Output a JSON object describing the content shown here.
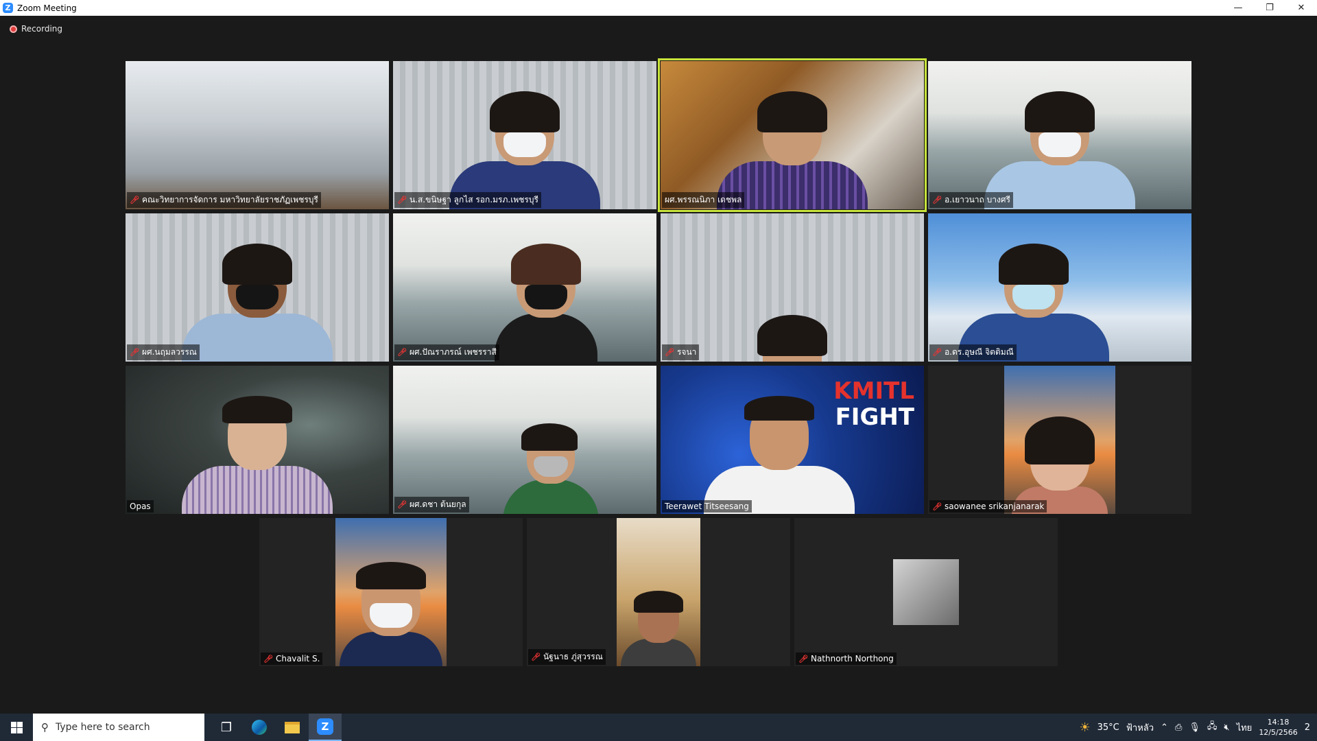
{
  "window": {
    "title": "Zoom Meeting",
    "logo_letter": "Z",
    "minimize": "—",
    "restore": "❐",
    "close": "✕"
  },
  "meeting": {
    "recording_label": "Recording",
    "active_speaker_color": "#c8e33a"
  },
  "participants": [
    {
      "name": "คณะวิทยาการจัดการ มหาวิทยาลัยราชภัฏเพชรบุรี",
      "muted": true,
      "active": false
    },
    {
      "name": "น.ส.ขนิษฐา ลูกไส รอก.มรภ.เพชรบุรี",
      "muted": true,
      "active": false
    },
    {
      "name": "ผศ.พรรณนิภา เดชพล",
      "muted": false,
      "active": true
    },
    {
      "name": "อ.เยาวนาถ บางศรี",
      "muted": true,
      "active": false
    },
    {
      "name": "ผศ.นฤมลวรรณ",
      "muted": true,
      "active": false
    },
    {
      "name": "ผศ.ปัณราภรณ์ เพชรราสี",
      "muted": true,
      "active": false
    },
    {
      "name": "รจนา",
      "muted": true,
      "active": false
    },
    {
      "name": "อ.ดร.อุษณี จิตติมณี",
      "muted": true,
      "active": false
    },
    {
      "name": "Opas",
      "muted": false,
      "active": false
    },
    {
      "name": "ผศ.ดชา ต้นยกุล",
      "muted": true,
      "active": false
    },
    {
      "name": "Teerawet Titseesang",
      "muted": false,
      "active": false
    },
    {
      "name": "saowanee srikanjanarak",
      "muted": true,
      "active": false
    },
    {
      "name": "Chavalit S.",
      "muted": true,
      "active": false
    },
    {
      "name": "นัฐนาธ ภู่สุวรรณ",
      "muted": true,
      "active": false
    },
    {
      "name": "Nathnorth Northong",
      "muted": true,
      "active": false
    }
  ],
  "virtual_bg": {
    "kmitl_line1": "KMITL",
    "kmitl_line2": "FIGHT"
  },
  "taskbar": {
    "search_placeholder": "Type here to search",
    "weather": "35°C",
    "weather_text": "ฟ้าหลัว",
    "language": "ไทย",
    "time": "14:18",
    "date": "12/5/2566",
    "notifications": "2"
  }
}
